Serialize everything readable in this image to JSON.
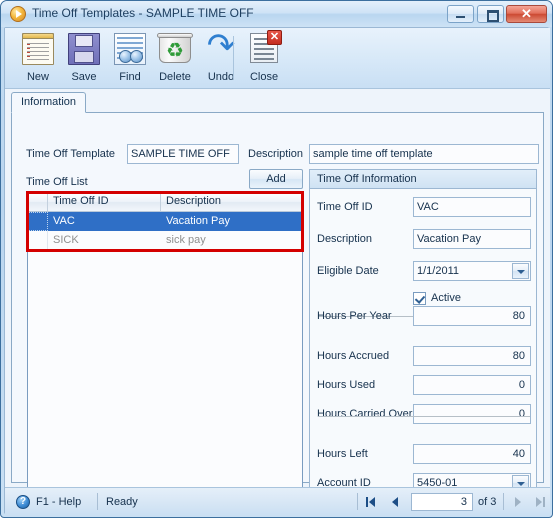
{
  "window": {
    "title": "Time Off Templates - SAMPLE TIME OFF",
    "app_icon": "play-circle-icon",
    "controls": {
      "minimize": "minimize-icon",
      "maximize": "maximize-icon",
      "close": "✕"
    }
  },
  "toolbar": {
    "items": [
      {
        "label": "New",
        "icon": "new-document-icon"
      },
      {
        "label": "Save",
        "icon": "floppy-disk-icon"
      },
      {
        "label": "Find",
        "icon": "binoculars-icon"
      },
      {
        "label": "Delete",
        "icon": "recycle-bin-icon"
      },
      {
        "label": "Undo",
        "icon": "undo-arrow-icon"
      },
      {
        "label": "Close",
        "icon": "close-document-icon"
      }
    ]
  },
  "tabs": [
    {
      "label": "Information",
      "active": true
    }
  ],
  "header": {
    "template_label": "Time Off Template",
    "template_value": "SAMPLE TIME OFF",
    "description_label": "Description",
    "description_value": "sample time off template"
  },
  "list_section": {
    "title": "Time Off List",
    "add_button": "Add",
    "columns": [
      "",
      "Time Off ID",
      "Description"
    ],
    "rows": [
      {
        "id": "VAC",
        "description": "Vacation Pay",
        "selected": true
      },
      {
        "id": "SICK",
        "description": "sick pay",
        "selected": false
      }
    ]
  },
  "info_panel": {
    "title": "Time Off Information",
    "fields": [
      {
        "label": "Time Off ID",
        "value": "VAC",
        "type": "text"
      },
      {
        "label": "Description",
        "value": "Vacation Pay",
        "type": "text"
      },
      {
        "label": "Eligible Date",
        "value": "1/1/2011",
        "type": "combo"
      },
      {
        "label": "Hours Per Year",
        "value": "80",
        "type": "number"
      },
      {
        "label": "Hours Accrued",
        "value": "80",
        "type": "number"
      },
      {
        "label": "Hours Used",
        "value": "0",
        "type": "number"
      },
      {
        "label": "Hours Carried Over",
        "value": "0",
        "type": "number"
      },
      {
        "label": "Hours Left",
        "value": "40",
        "type": "number"
      },
      {
        "label": "Account ID",
        "value": "5450-01",
        "type": "combo"
      }
    ],
    "active_checkbox": {
      "label": "Active",
      "checked": true
    }
  },
  "statusbar": {
    "help_icon": "question-mark-icon",
    "help_text": "F1 - Help",
    "status_text": "Ready",
    "record_position": "3",
    "record_of": "of 3",
    "nav": {
      "first": "first-record-icon",
      "previous": "previous-record-icon",
      "next": "next-record-icon",
      "last": "last-record-icon"
    }
  },
  "annotation": {
    "color": "#d40000",
    "target": "time-off-list-grid-rows"
  }
}
